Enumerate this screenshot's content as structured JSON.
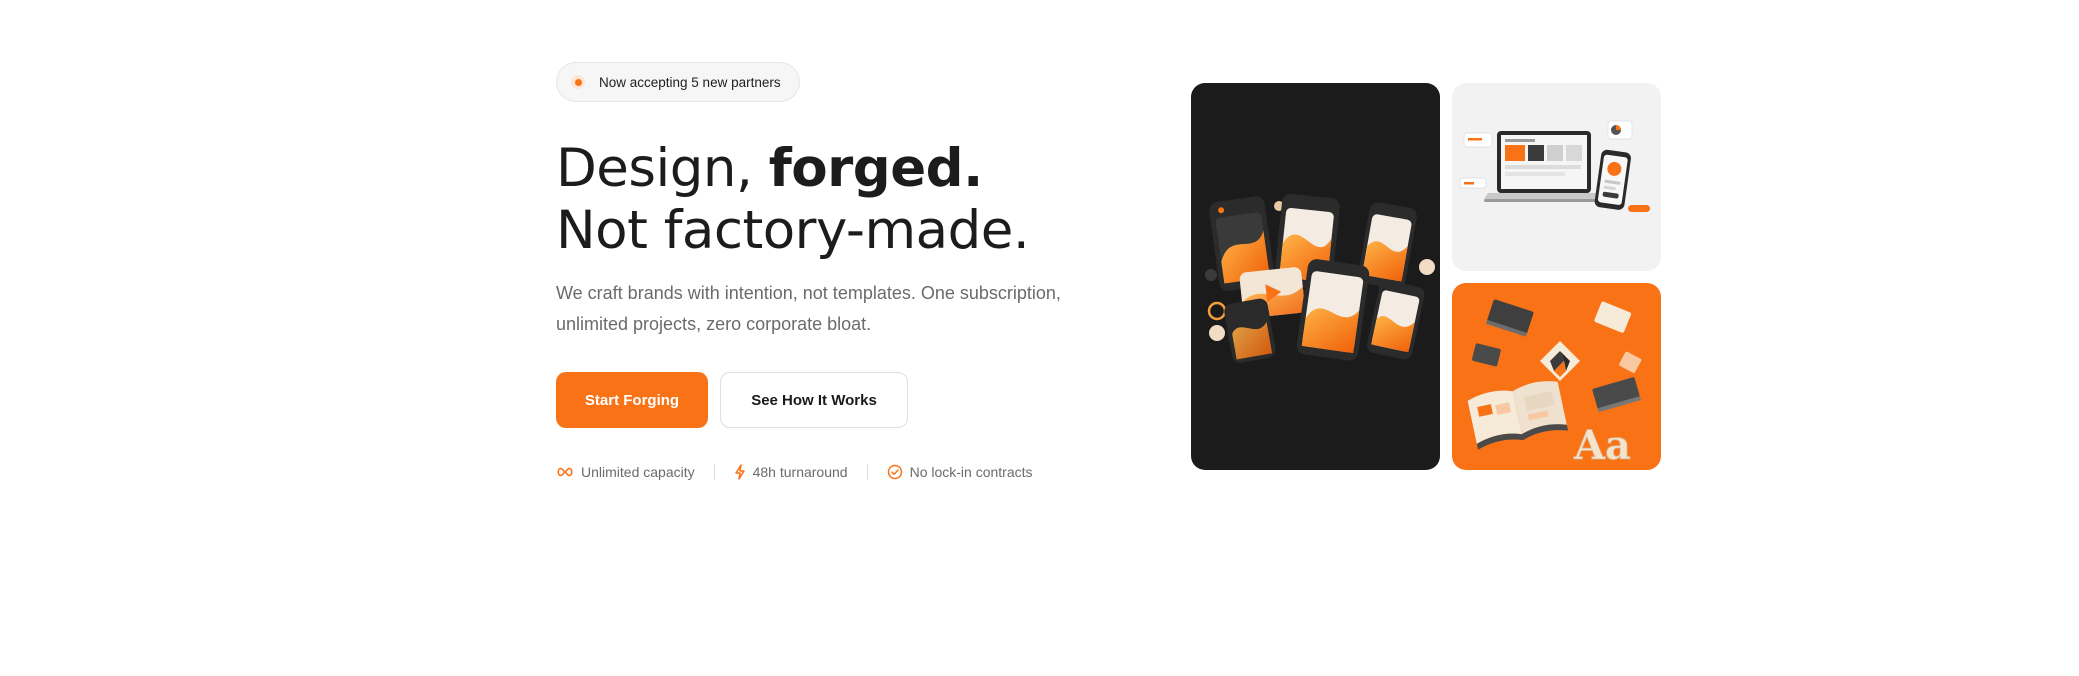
{
  "badge": {
    "text": "Now accepting 5 new partners"
  },
  "headline": {
    "part1": "Design, ",
    "bold": "forged.",
    "part2": " Not factory-made."
  },
  "subtitle": "We craft brands with intention, not templates. One subscription, unlimited projects, zero corporate bloat.",
  "buttons": {
    "primary": "Start Forging",
    "secondary": "See How It Works"
  },
  "features": [
    {
      "icon": "infinity-icon",
      "label": "Unlimited capacity"
    },
    {
      "icon": "lightning-icon",
      "label": "48h turnaround"
    },
    {
      "icon": "check-circle-icon",
      "label": "No lock-in contracts"
    }
  ],
  "tiles": [
    {
      "name": "dark-phones-illustration",
      "color": "#1b1b1b"
    },
    {
      "name": "laptop-mockup-illustration",
      "color": "#f2f2f2"
    },
    {
      "name": "brand-books-illustration",
      "color": "#f97316"
    }
  ],
  "colors": {
    "accent": "#f97316",
    "text": "#1c1c1c",
    "muted": "#6b6b6b"
  }
}
